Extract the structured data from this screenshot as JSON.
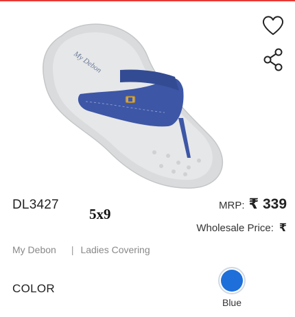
{
  "product": {
    "sku": "DL3427",
    "size_tag": "5x9",
    "brand": "My Debon",
    "category": "Ladies Covering",
    "mrp_label": "MRP:",
    "mrp_value": "₹ 339",
    "wholesale_label": "Wholesale Price:",
    "wholesale_value": "₹",
    "image_brand_text": "My Debon"
  },
  "actions": {
    "wishlist_icon": "heart-outline-icon",
    "share_icon": "share-icon"
  },
  "color": {
    "label": "COLOR",
    "options": [
      {
        "name": "Blue",
        "hex": "#1e6fd9",
        "selected": true
      }
    ]
  },
  "theme": {
    "accent": "#e53935",
    "strap": "#3d56a6",
    "sole": "#d9dbdc"
  }
}
